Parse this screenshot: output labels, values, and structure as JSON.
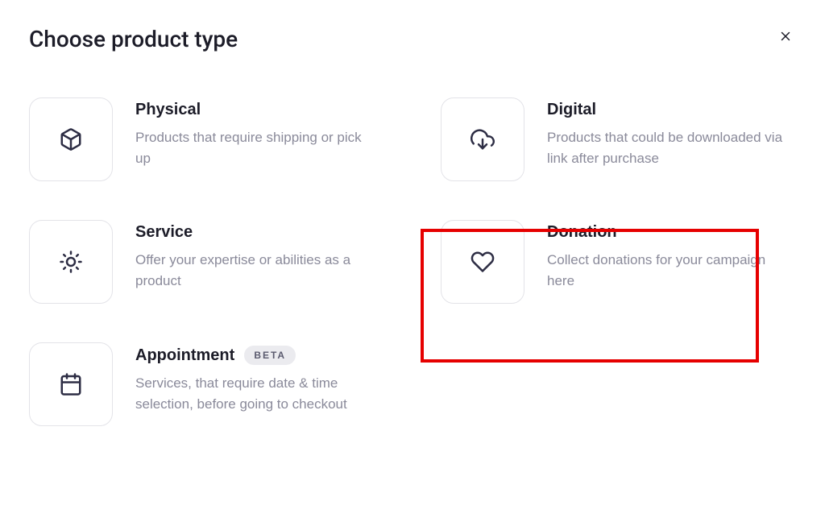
{
  "title": "Choose product type",
  "options": [
    {
      "title": "Physical",
      "description": "Products that require shipping or pick up",
      "icon": "package",
      "badge": null
    },
    {
      "title": "Digital",
      "description": "Products that could be downloaded via link after purchase",
      "icon": "cloud-download",
      "badge": null
    },
    {
      "title": "Service",
      "description": "Offer your expertise or abilities as a product",
      "icon": "sun",
      "badge": null
    },
    {
      "title": "Donation",
      "description": "Collect donations for your campaign here",
      "icon": "heart",
      "badge": null,
      "highlighted": true
    },
    {
      "title": "Appointment",
      "description": "Services, that require date & time selection, before going to checkout",
      "icon": "calendar",
      "badge": "BETA"
    }
  ]
}
